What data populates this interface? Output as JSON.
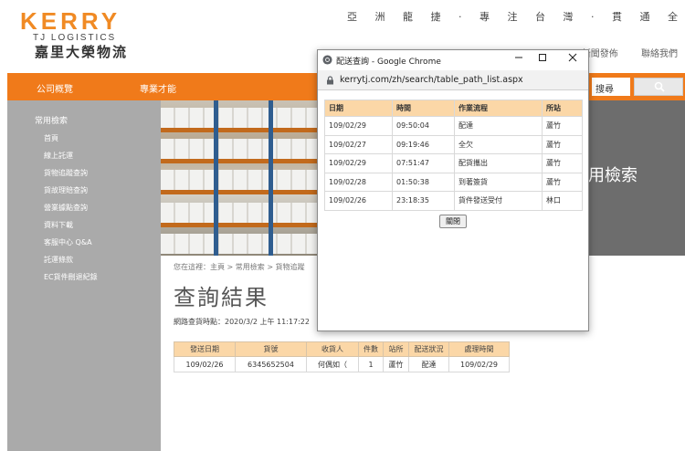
{
  "header": {
    "logo_brand": "KERRY",
    "logo_sub": "TJ LOGISTICS",
    "logo_cn": "嘉里大榮物流",
    "slogan": "亞 洲 龍 捷 · 專 注 台 灣 · 貫 通 全 球",
    "top_links": [
      "新聞發佈",
      "聯絡我們"
    ]
  },
  "nav": {
    "items": [
      "公司概覽",
      "專業才能"
    ],
    "search_placeholder": "搜尋"
  },
  "sidebar": {
    "heading": "常用檢索",
    "items": [
      "首頁",
      "線上託運",
      "貨物追蹤查詢",
      "貨故理賠查詢",
      "營業據點查詢",
      "資料下載",
      "客服中心 Q&A",
      "託運條款",
      "EC貨件刪退紀錄"
    ]
  },
  "banner": {
    "title": "用檢索"
  },
  "main": {
    "breadcrumb": "您在這裡：主頁 > 常用檢索 > 貨物追蹤",
    "title": "查詢結果",
    "query_time": "網路查貨時點：2020/3/2 上午 11:17:22",
    "table": {
      "headers": [
        "發送日期",
        "貨號",
        "收貨人",
        "件數",
        "站所",
        "配送狀況",
        "處理時間"
      ],
      "rows": [
        [
          "109/02/26",
          "6345652504",
          "何偶如（",
          "1",
          "蘆竹",
          "配達",
          "109/02/29"
        ]
      ]
    }
  },
  "popup": {
    "window_title": "配送查詢 - Google Chrome",
    "url": "kerrytj.com/zh/search/table_path_list.aspx",
    "table": {
      "headers": [
        "日期",
        "時間",
        "作業流程",
        "所站"
      ],
      "rows": [
        [
          "109/02/29",
          "09:50:04",
          "配達",
          "蘆竹"
        ],
        [
          "109/02/27",
          "09:19:46",
          "全欠",
          "蘆竹"
        ],
        [
          "109/02/29",
          "07:51:47",
          "配貨攜出",
          "蘆竹"
        ],
        [
          "109/02/28",
          "01:50:38",
          "到著簽貨",
          "蘆竹"
        ],
        [
          "109/02/26",
          "23:18:35",
          "貨件發送受付",
          "林口"
        ]
      ]
    },
    "close_label": "關閉"
  },
  "colors": {
    "brand_orange": "#f07a1a",
    "table_header": "#fbd7a7",
    "sidebar_gray": "#aaaaaa"
  }
}
